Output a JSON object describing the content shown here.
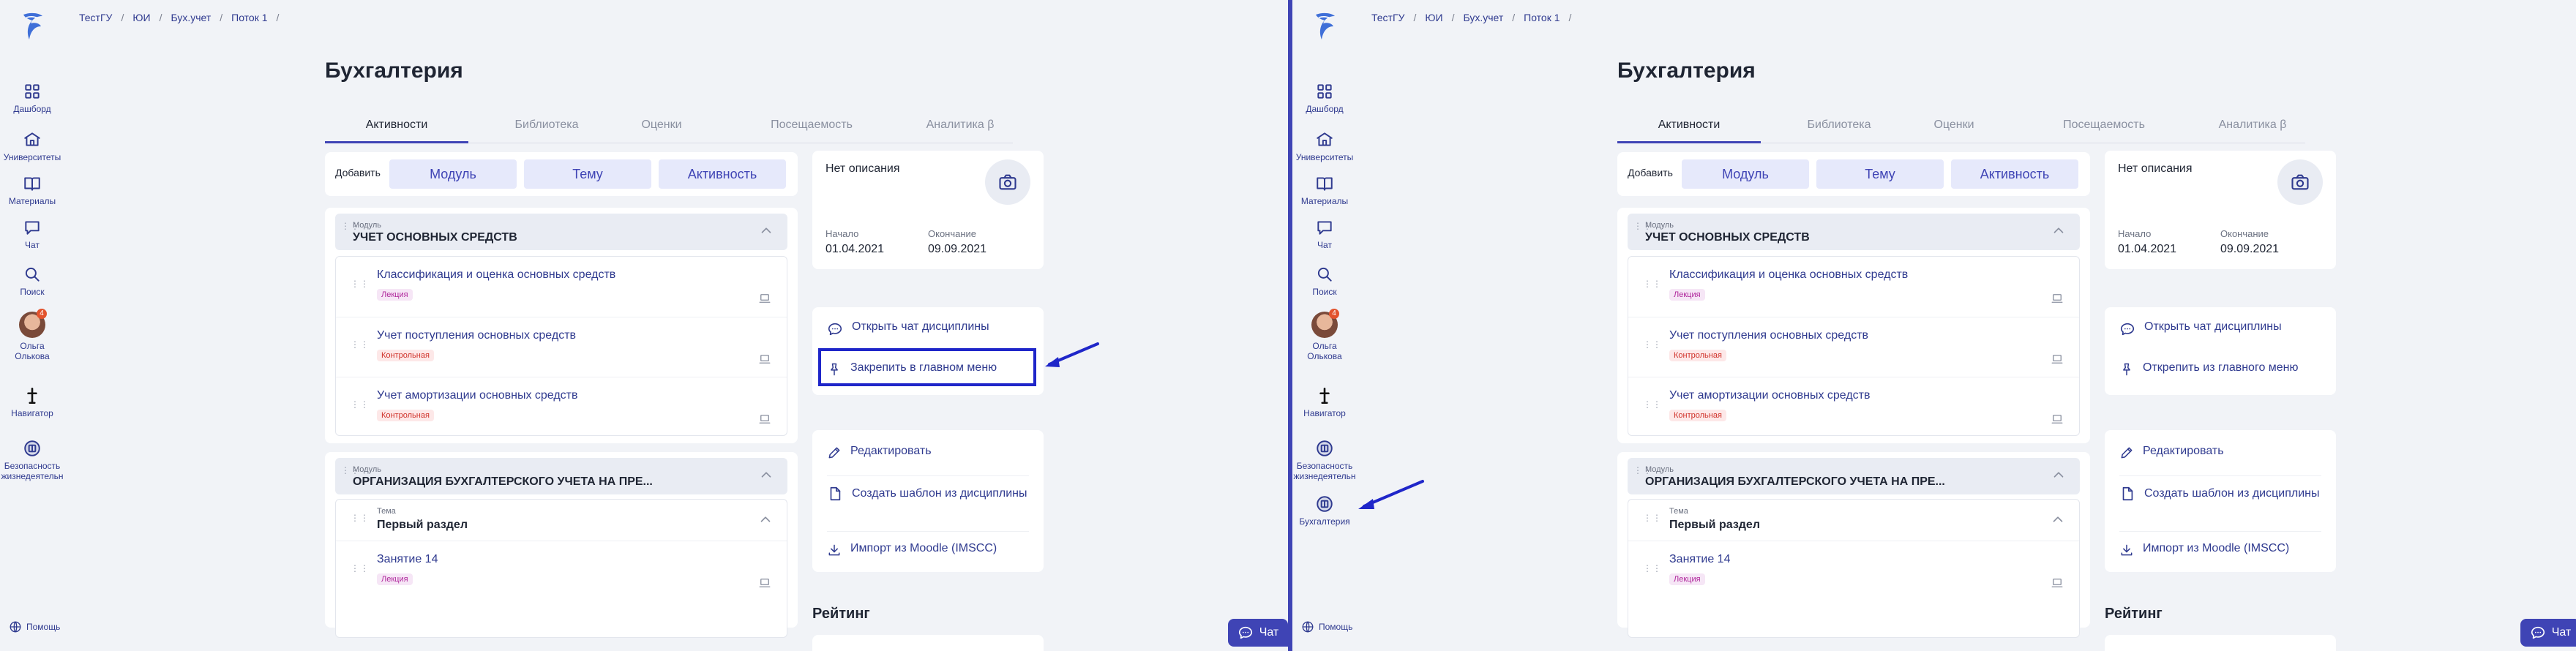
{
  "colors": {
    "accent": "#3f44b5",
    "highlight": "#1f26c9",
    "sidebar_text": "#2f3a8f",
    "background": "#f1f3f7"
  },
  "left": {
    "breadcrumb": [
      "ТестГУ",
      "ЮИ",
      "Бух.учет",
      "Поток 1"
    ],
    "sidebar": [
      {
        "label": "Дашборд",
        "icon": "dashboard-icon"
      },
      {
        "label": "Университеты",
        "icon": "university-icon"
      },
      {
        "label": "Материалы",
        "icon": "book-icon"
      },
      {
        "label": "Чат",
        "icon": "chat-icon"
      },
      {
        "label": "Поиск",
        "icon": "search-icon"
      },
      {
        "label": "Ольга\nОлькова",
        "icon": "avatar",
        "badge": "4"
      },
      {
        "label": "Навигатор",
        "icon": "navigator-icon"
      },
      {
        "label": "Безопасность\nжизнедеятельн",
        "icon": "course-icon"
      }
    ],
    "help": "Помощь",
    "page_title": "Бухгалтерия",
    "tabs": [
      "Активности",
      "Библиотека",
      "Оценки",
      "Посещаемость",
      "Аналитика β"
    ],
    "add_bar": {
      "label": "Добавить",
      "buttons": [
        "Модуль",
        "Тему",
        "Активность"
      ]
    },
    "modules": [
      {
        "small": "Модуль",
        "title": "УЧЕТ ОСНОВНЫХ СРЕДСТВ",
        "lessons": [
          {
            "title": "Классификация и оценка основных средств",
            "tag": "Лекция"
          },
          {
            "title": "Учет поступления основных средств",
            "tag": "Контрольная"
          },
          {
            "title": "Учет амортизации основных средств",
            "tag": "Контрольная"
          }
        ]
      },
      {
        "small": "Модуль",
        "title": "ОРГАНИЗАЦИЯ БУХГАЛТЕРСКОГО УЧЕТА НА ПРЕ...",
        "section_small": "Тема",
        "section_title": "Первый раздел",
        "lessons": [
          {
            "title": "Занятие 14",
            "tag": "Лекция"
          }
        ]
      }
    ],
    "info": {
      "no_description": "Нет описания",
      "start_label": "Начало",
      "start": "01.04.2021",
      "end_label": "Окончание",
      "end": "09.09.2021"
    },
    "actions1": [
      "Открыть чат дисциплины",
      "Закрепить в главном меню"
    ],
    "actions2": [
      "Редактировать",
      "Создать шаблон из дисциплины",
      "Импорт из Moodle (IMSCC)"
    ],
    "rating": "Рейтинг",
    "chat_button": "Чат"
  },
  "right": {
    "breadcrumb": [
      "ТестГУ",
      "ЮИ",
      "Бух.учет",
      "Поток 1"
    ],
    "sidebar": [
      {
        "label": "Дашборд",
        "icon": "dashboard-icon"
      },
      {
        "label": "Университеты",
        "icon": "university-icon"
      },
      {
        "label": "Материалы",
        "icon": "book-icon"
      },
      {
        "label": "Чат",
        "icon": "chat-icon"
      },
      {
        "label": "Поиск",
        "icon": "search-icon"
      },
      {
        "label": "Ольга\nОлькова",
        "icon": "avatar",
        "badge": "4"
      },
      {
        "label": "Навигатор",
        "icon": "navigator-icon"
      },
      {
        "label": "Безопасность\nжизнедеятельн",
        "icon": "course-icon"
      },
      {
        "label": "Бухгалтерия",
        "icon": "course-icon"
      }
    ],
    "help": "Помощь",
    "page_title": "Бухгалтерия",
    "tabs": [
      "Активности",
      "Библиотека",
      "Оценки",
      "Посещаемость",
      "Аналитика β"
    ],
    "add_bar": {
      "label": "Добавить",
      "buttons": [
        "Модуль",
        "Тему",
        "Активность"
      ]
    },
    "modules": [
      {
        "small": "Модуль",
        "title": "УЧЕТ ОСНОВНЫХ СРЕДСТВ",
        "lessons": [
          {
            "title": "Классификация и оценка основных средств",
            "tag": "Лекция"
          },
          {
            "title": "Учет поступления основных средств",
            "tag": "Контрольная"
          },
          {
            "title": "Учет амортизации основных средств",
            "tag": "Контрольная"
          }
        ]
      },
      {
        "small": "Модуль",
        "title": "ОРГАНИЗАЦИЯ БУХГАЛТЕРСКОГО УЧЕТА НА ПРЕ...",
        "section_small": "Тема",
        "section_title": "Первый раздел",
        "lessons": [
          {
            "title": "Занятие 14",
            "tag": "Лекция"
          }
        ]
      }
    ],
    "info": {
      "no_description": "Нет описания",
      "start_label": "Начало",
      "start": "01.04.2021",
      "end_label": "Окончание",
      "end": "09.09.2021"
    },
    "actions1": [
      "Открыть чат дисциплины",
      "Открепить из главного меню"
    ],
    "actions2": [
      "Редактировать",
      "Создать шаблон из дисциплины",
      "Импорт из Moodle (IMSCC)"
    ],
    "rating": "Рейтинг",
    "chat_button": "Чат"
  }
}
